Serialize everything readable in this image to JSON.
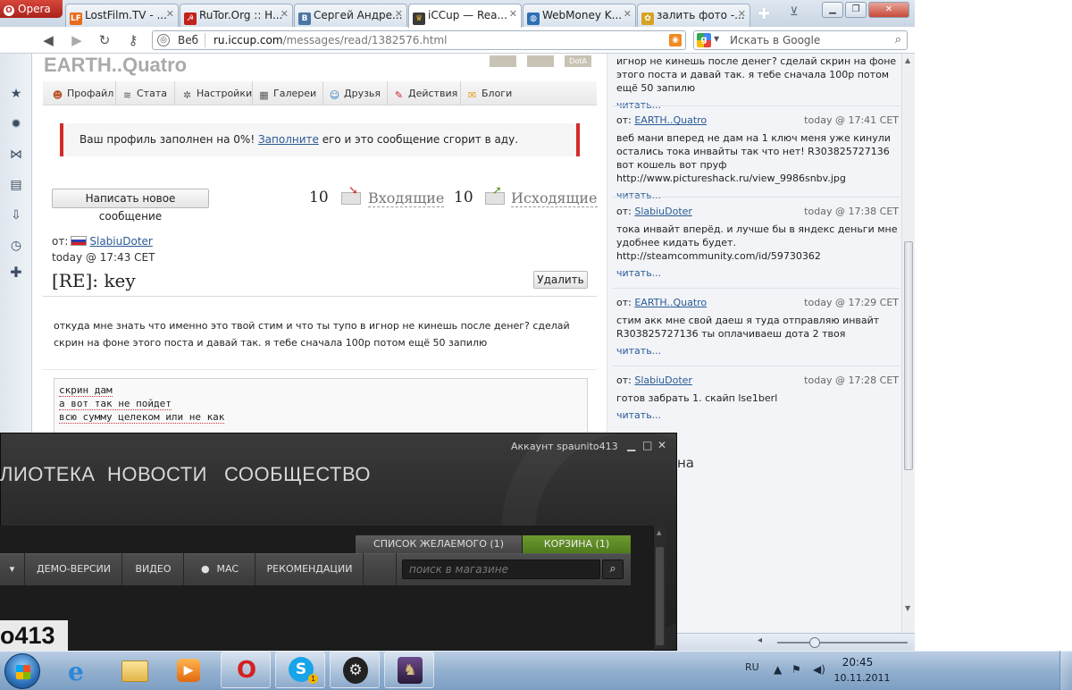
{
  "browser": {
    "menu_label": "Opera",
    "tabs": [
      {
        "label": "LostFilm.TV - ...",
        "favicon": "LF"
      },
      {
        "label": "RuTor.Org :: H...",
        "favicon": "☭"
      },
      {
        "label": "Сергей Андре...",
        "favicon": "B"
      },
      {
        "label": "iCCup — Rea...",
        "favicon": "♛"
      },
      {
        "label": "WebMoney K...",
        "favicon": "◍"
      },
      {
        "label": "залить фото -...",
        "favicon": "✿"
      }
    ],
    "address": {
      "mode": "Веб",
      "url_host": "ru.iccup.com",
      "url_path": "/messages/read/1382576.html"
    },
    "search_placeholder": "Искать в Google"
  },
  "profile": {
    "name": "EARTH..Quatro",
    "badges": [
      "",
      "",
      "DotA"
    ],
    "nav": [
      {
        "label": "Профайл",
        "icon": "person-icon"
      },
      {
        "label": "Стата",
        "icon": "stats-icon"
      },
      {
        "label": "Настройки",
        "icon": "gear-icon"
      },
      {
        "label": "Галереи",
        "icon": "gallery-icon"
      },
      {
        "label": "Друзья",
        "icon": "friends-icon"
      },
      {
        "label": "Действия",
        "icon": "pencil-icon"
      },
      {
        "label": "Блоги",
        "icon": "blog-icon"
      }
    ],
    "notice_before": "Ваш профиль заполнен на 0%! ",
    "notice_link": "Заполните",
    "notice_after": " его и это сообщение сгорит в аду."
  },
  "messages": {
    "new_button": "Написать новое сообщение",
    "inbox_count": "10",
    "inbox_label": "Входящие",
    "outbox_count": "10",
    "outbox_label": "Исходящие",
    "from_label": "от:",
    "from_user": "SlabiuDoter",
    "date": "today @ 17:43 CET",
    "title": "[RE]: key",
    "delete_button": "Удалить",
    "body": "откуда мне знать что именно это твой стим и что ты тупо в игнор не кинешь после денег? сделай скрин на фоне этого поста и давай так. я тебе сначала 100р потом ещё 50 запилю",
    "quote_lines": [
      "скрин дам",
      "а вот так не пойдет",
      "всю сумму целеком или не как"
    ]
  },
  "sidebar": {
    "read_more": "читать...",
    "top_text": "игнор не кинешь после денег? сделай скрин на фоне этого поста и давай так. я тебе сначала 100р потом ещё 50 запилю",
    "items": [
      {
        "from_label": "от:",
        "user": "EARTH..Quatro",
        "time": "today @ 17:41 CET",
        "text": "веб мани вперед не дам на 1 ключ меня уже кинули остались тока инвайты так что нет! R303825727136 вот кошель вот пруф http://www.pictureshack.ru/view_9986snbv.jpg"
      },
      {
        "from_label": "от:",
        "user": "SlabiuDoter",
        "time": "today @ 17:38 CET",
        "text": "тока инвайт вперёд. и лучше бы в яндекс деньги мне удобнее кидать будет. http://steamcommunity.com/id/59730362"
      },
      {
        "from_label": "от:",
        "user": "EARTH..Quatro",
        "time": "today @ 17:29 CET",
        "text": "стим акк мне свой даеш я туда отправляю инвайт R303825727136 ты оплачиваеш дота 2 твоя"
      },
      {
        "from_label": "от:",
        "user": "SlabiuDoter",
        "time": "today @ 17:28 CET",
        "text": "готов забрать 1. скайп lse1berl"
      }
    ],
    "partial_heading": "на"
  },
  "steam": {
    "account": "Аккаунт spaunito413",
    "nav": [
      "ЛИОТЕКА",
      "НОВОСТИ",
      "СООБЩЕСТВО"
    ],
    "wishlist": "СПИСОК ЖЕЛАЕМОГО (1)",
    "cart": "КОРЗИНА (1)",
    "store_items": [
      "ДЕМО-ВЕРСИИ",
      "ВИДЕО",
      "MAC",
      "РЕКОМЕНДАЦИИ"
    ],
    "search_placeholder": "поиск в магазине",
    "user_fragment": "o413"
  },
  "taskbar": {
    "apps": [
      "internet-explorer-icon",
      "file-explorer-icon",
      "media-player-icon",
      "opera-icon",
      "skype-icon",
      "steam-icon",
      "game-icon"
    ],
    "lang": "RU",
    "time": "20:45",
    "date": "10.11.2011"
  }
}
